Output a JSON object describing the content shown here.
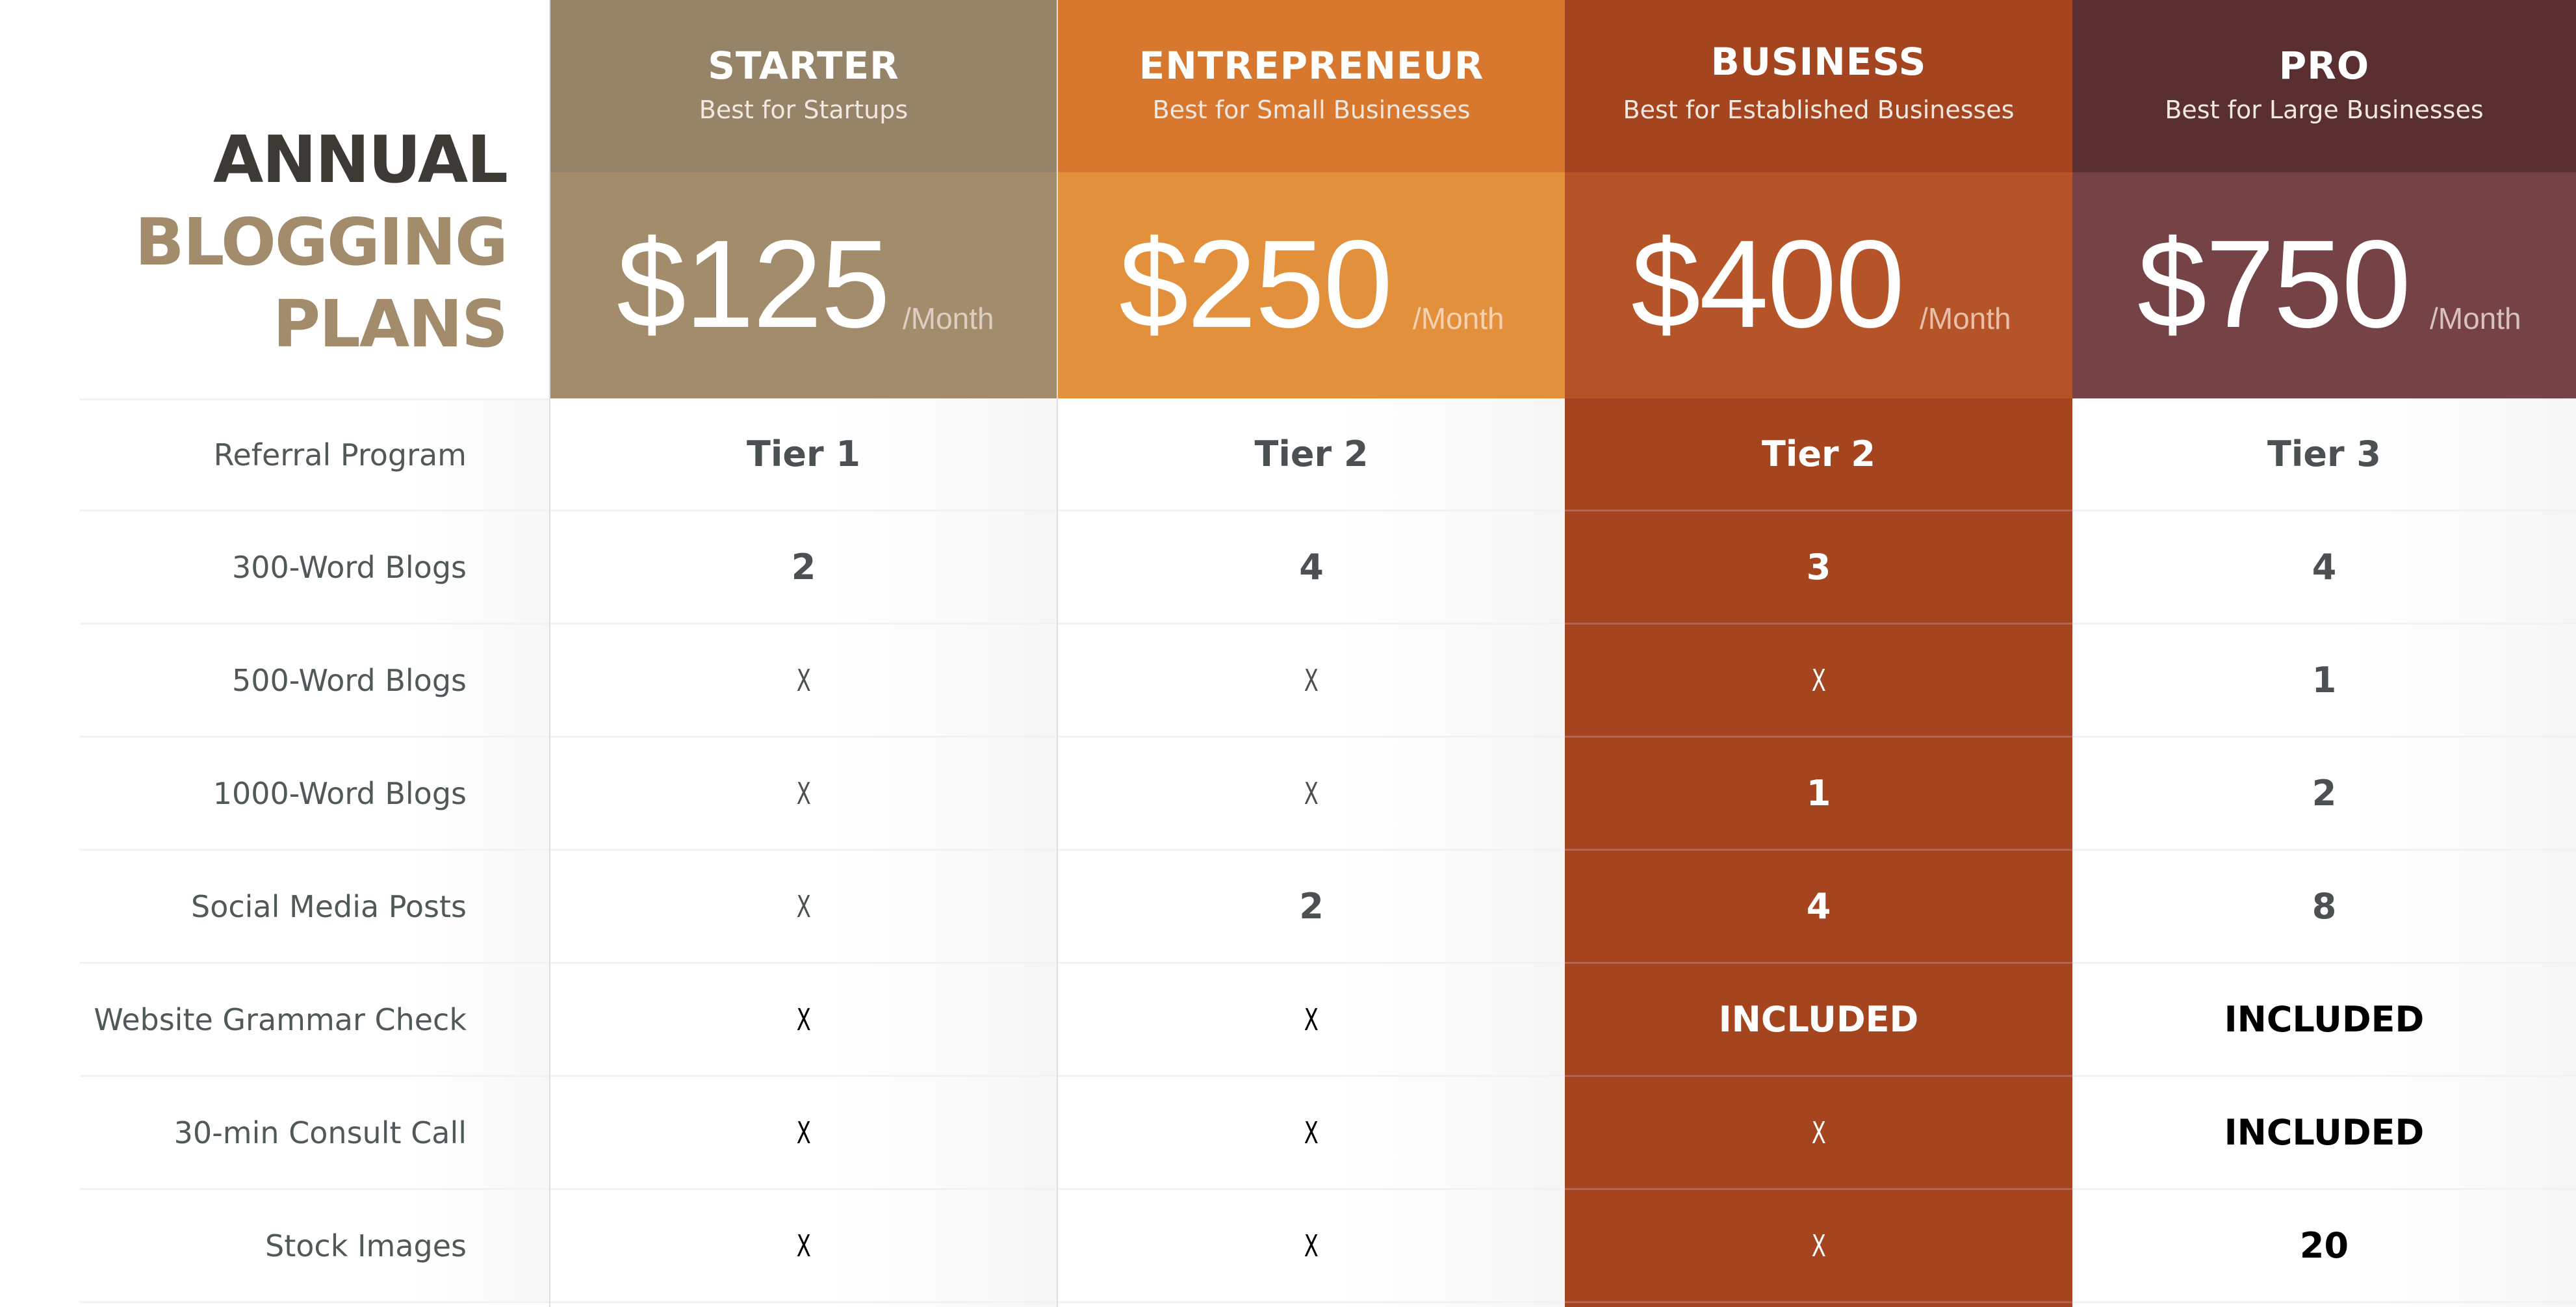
{
  "title": {
    "line1": "ANNUAL",
    "line2": "BLOGGING",
    "line3": "PLANS"
  },
  "colors": {
    "title_dark": "#3d3a35",
    "title_accent": "#a38c6b",
    "starter_header": "#958467",
    "starter_price": "#a38c6b",
    "entrepreneur_header": "#d8782e",
    "entrepreneur_price": "#e3903c",
    "business_header": "#a44520",
    "business_price": "#b55429",
    "business_body": "#a44520",
    "pro_header": "#5a2f32",
    "pro_price": "#754245"
  },
  "features": [
    "Referral Program",
    "300-Word Blogs",
    "500-Word Blogs",
    "1000-Word Blogs",
    "Social Media Posts",
    "Website Grammar Check",
    "30-min Consult Call",
    "Stock Images"
  ],
  "plans": [
    {
      "name": "STARTER",
      "subtitle": "Best for Startups",
      "price": "$125",
      "period": "/Month",
      "values": [
        "Tier 1",
        "2",
        "X",
        "X",
        "X",
        "X",
        "X",
        "X"
      ]
    },
    {
      "name": "ENTREPRENEUR",
      "subtitle": "Best for Small Businesses",
      "price": "$250",
      "period": "/Month",
      "values": [
        "Tier 2",
        "4",
        "X",
        "X",
        "2",
        "X",
        "X",
        "X"
      ]
    },
    {
      "name": "BUSINESS",
      "subtitle": "Best for Established Businesses",
      "price": "$400",
      "period": "/Month",
      "values": [
        "Tier 2",
        "3",
        "X",
        "1",
        "4",
        "INCLUDED",
        "X",
        "X"
      ]
    },
    {
      "name": "PRO",
      "subtitle": "Best for Large Businesses",
      "price": "$750",
      "period": "/Month",
      "values": [
        "Tier 3",
        "4",
        "1",
        "2",
        "8",
        "INCLUDED",
        "INCLUDED",
        "20"
      ]
    }
  ]
}
